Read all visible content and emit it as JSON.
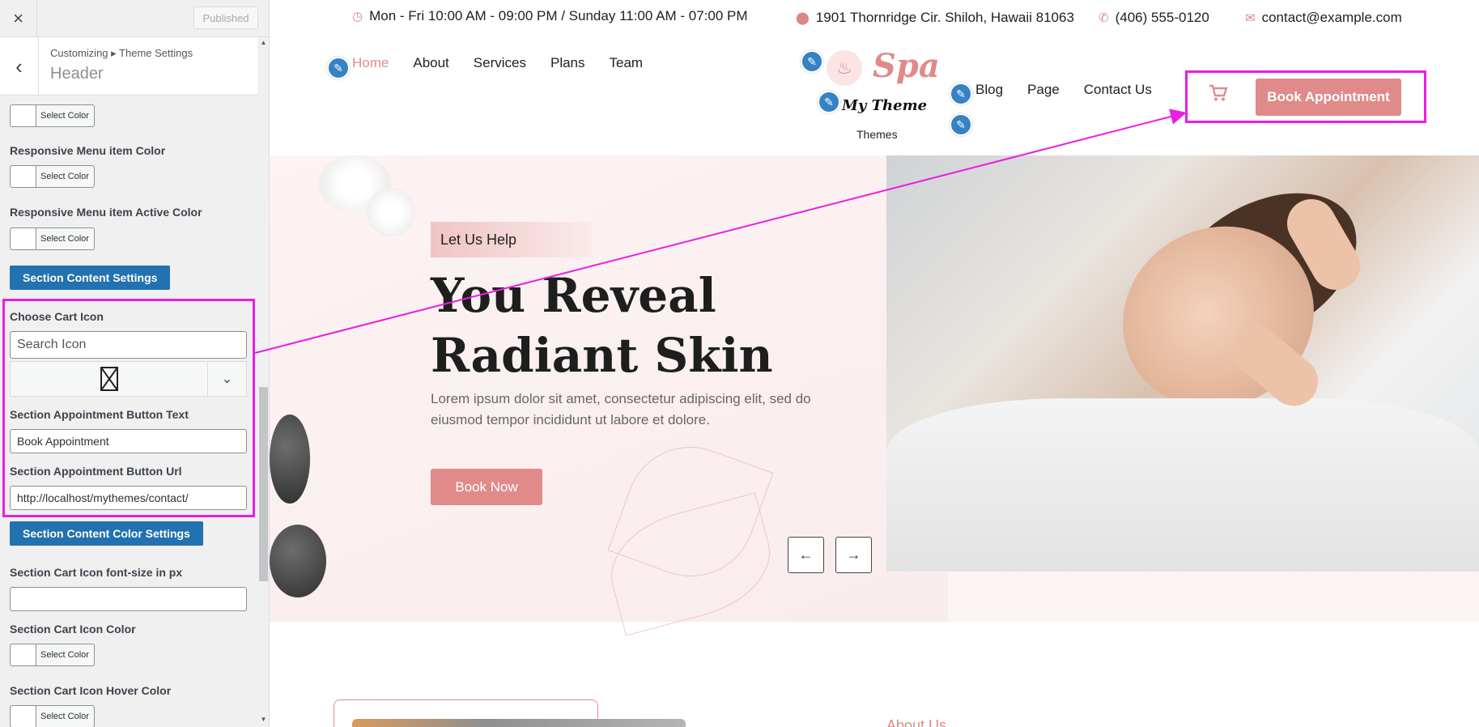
{
  "sidebar": {
    "close_label": "×",
    "published_label": "Published",
    "back_label": "‹",
    "breadcrumb": "Customizing ▸ Theme Settings",
    "title": "Header",
    "color_button_label": "Select Color",
    "responsive_menu_item_color_label": "Responsive Menu item Color",
    "responsive_menu_item_active_color_label": "Responsive Menu item Active Color",
    "section_content_settings_label": "Section Content Settings",
    "choose_cart_icon_label": "Choose Cart Icon",
    "search_icon_placeholder": "Search Icon",
    "appointment_button_text_label": "Section Appointment Button Text",
    "appointment_button_text_value": "Book Appointment",
    "appointment_button_url_label": "Section Appointment Button Url",
    "appointment_button_url_value": "http://localhost/mythemes/contact/",
    "section_content_color_settings_label": "Section Content Color Settings",
    "cart_icon_font_size_label": "Section Cart Icon font-size in px",
    "cart_icon_font_size_value": "",
    "cart_icon_color_label": "Section Cart Icon Color",
    "cart_icon_hover_color_label": "Section Cart Icon Hover Color"
  },
  "preview": {
    "topbar": {
      "hours": "Mon - Fri 10:00 AM - 09:00 PM / Sunday 11:00 AM - 07:00 PM",
      "address": "1901 Thornridge Cir. Shiloh, Hawaii 81063",
      "phone": "(406) 555-0120",
      "email": "contact@example.com"
    },
    "nav_left": [
      "Home",
      "About",
      "Services",
      "Plans",
      "Team"
    ],
    "nav_right": [
      "Blog",
      "Page",
      "Contact Us"
    ],
    "logo": {
      "spa": "Spa",
      "name": "My Theme",
      "sub": "Themes"
    },
    "book_appointment_label": "Book Appointment",
    "hero": {
      "tagline": "Let Us Help",
      "title": "You Reveal Radiant Skin",
      "text": "Lorem ipsum dolor sit amet, consectetur adipiscing elit, sed do eiusmod tempor incididunt ut labore et dolore.",
      "button": "Book Now",
      "prev_arrow": "←",
      "next_arrow": "→"
    },
    "about_label": "About Us"
  },
  "colors": {
    "accent": "#e08a8a",
    "wp_blue": "#2271b1",
    "highlight": "#e91ee3"
  }
}
